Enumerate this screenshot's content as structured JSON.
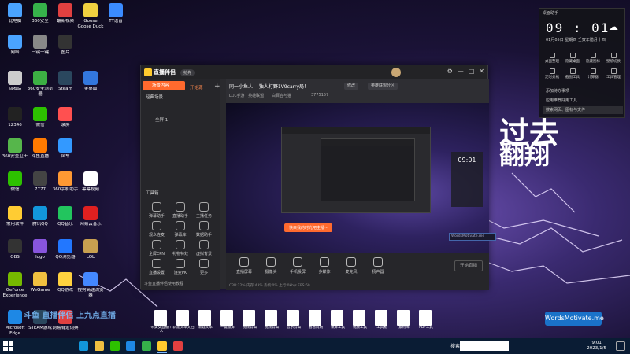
{
  "desktop": {
    "icons": [
      {
        "label": "此电脑",
        "color": "#4aa3ff"
      },
      {
        "label": "360安全",
        "color": "#36b24a"
      },
      {
        "label": "最新视频",
        "color": "#e04040"
      },
      {
        "label": "Goose Goose Duck",
        "color": "#f0d040"
      },
      {
        "label": "TT语音",
        "color": "#3b8bff"
      },
      {
        "label": "网络",
        "color": "#4aa3ff"
      },
      {
        "label": "一键一键",
        "color": "#888888"
      },
      {
        "label": "图片",
        "color": "#333333"
      },
      {
        "label": "回收站",
        "color": "#cccccc"
      },
      {
        "label": "360安全浏览器",
        "color": "#3cb043"
      },
      {
        "label": "Steam",
        "color": "#2a475e"
      },
      {
        "label": "金桌面",
        "color": "#3377dd"
      },
      {
        "label": "12346",
        "color": "#222222"
      },
      {
        "label": "微信",
        "color": "#2dc100"
      },
      {
        "label": "录屏",
        "color": "#ff5050"
      },
      {
        "label": "360安全卫士",
        "color": "#56b64b"
      },
      {
        "label": "斗鱼直播",
        "color": "#ff7a00"
      },
      {
        "label": "风车",
        "color": "#3399ff"
      },
      {
        "label": "微信",
        "color": "#2dc100"
      },
      {
        "label": "7777",
        "color": "#444444"
      },
      {
        "label": "360手机助手",
        "color": "#ff9933"
      },
      {
        "label": "幂幂视频",
        "color": "#ffffff"
      },
      {
        "label": "常用软件",
        "color": "#ffcc33"
      },
      {
        "label": "腾讯QQ",
        "color": "#1296db"
      },
      {
        "label": "QQ音乐",
        "color": "#22c55e"
      },
      {
        "label": "网易云音乐",
        "color": "#e02020"
      },
      {
        "label": "OBS",
        "color": "#333333"
      },
      {
        "label": "logo",
        "color": "#8855dd"
      },
      {
        "label": "QQ浏览器",
        "color": "#2277ff"
      },
      {
        "label": "LOL",
        "color": "#c8a050"
      },
      {
        "label": "GeForce Experience",
        "color": "#76b900"
      },
      {
        "label": "WeGame",
        "color": "#f0c040"
      },
      {
        "label": "QQ游戏",
        "color": "#ffd23f"
      },
      {
        "label": "搜狗高速浏览器",
        "color": "#4488ff"
      },
      {
        "label": "Microsoft Edge",
        "color": "#1e88e5"
      },
      {
        "label": "STEAM游戏",
        "color": "#2a475e"
      },
      {
        "label": "网易有道词典",
        "color": "#e04040"
      }
    ]
  },
  "app": {
    "title": "直播伴侣",
    "version_badge": "抢先",
    "sidebar": {
      "active_tab": "场景内容",
      "row1": "经典场景",
      "scene_row": "全屏 1",
      "source_header": "开始源",
      "tools_title": "工具箱",
      "tools": [
        "弹幕助手",
        "直播助手",
        "主播任务",
        "观众连麦",
        "弹幕库",
        "数据助手",
        "全屏EPN",
        "礼物特效",
        "虚拟背景",
        "直播设置",
        "连麦PK",
        "更多"
      ],
      "footer": "斗鱼直播伴侣使用教程"
    },
    "topbar": {
      "room_title": "同一小鱼人！ 独人打野1V9carry局！",
      "edit_pill": "修改",
      "tag_pill": "英雄联盟分区",
      "meta_items": [
        "LOL手游 · 英雄联盟",
        "白百合与猫",
        "3775157"
      ]
    },
    "preview": {
      "cta": "快来我的时光吧主播~",
      "clock_time": "09:01",
      "overlay_line1": "过去",
      "overlay_line2": "翻翔"
    },
    "actions": [
      "直播屏幕",
      "摄像头",
      "手机投屏",
      "多媒体",
      "麦克风",
      "扬声器"
    ],
    "start_button": "开始直播",
    "status_line": "CPU:22%   内存:43%   丢帧:0%   上行:0kb/s   FPS:60"
  },
  "gadget": {
    "header": "桌面助手",
    "time": "09 : 01",
    "date": "01月05日 星期四   壬寅年腊月十四",
    "buttons": [
      "桌面整理",
      "隐藏桌面",
      "隐藏图标",
      "壁纸切换",
      "定时关机",
      "截图工具",
      "计算器",
      "工具管理"
    ],
    "rows": [
      "添加待办事项",
      "应用推荐好用工具",
      "搜索网页、图标与文件"
    ]
  },
  "widgets": {
    "small_blue": "WordsMotivate.me",
    "motivate": "WordsMotivate.me"
  },
  "docs": [
    "带美女直播个人",
    "新建文本文档",
    "新建文本",
    "一键锁屏",
    "视频剪辑",
    "视频剪辑",
    "音乐剪辑",
    "看看周期",
    "录屏工具",
    "视频工具",
    "工具箱",
    "素材库",
    "PDF工具"
  ],
  "logo_text": "斗鱼 直播伴侣 上九点直播",
  "taskbar": {
    "search_label": "搜索",
    "time": "9:01",
    "date": "2023/1/5",
    "colors": [
      "#1296db",
      "#f0c040",
      "#2dc100",
      "#1e88e5",
      "#36b24a",
      "#ffcb2e",
      "#e04040"
    ]
  }
}
